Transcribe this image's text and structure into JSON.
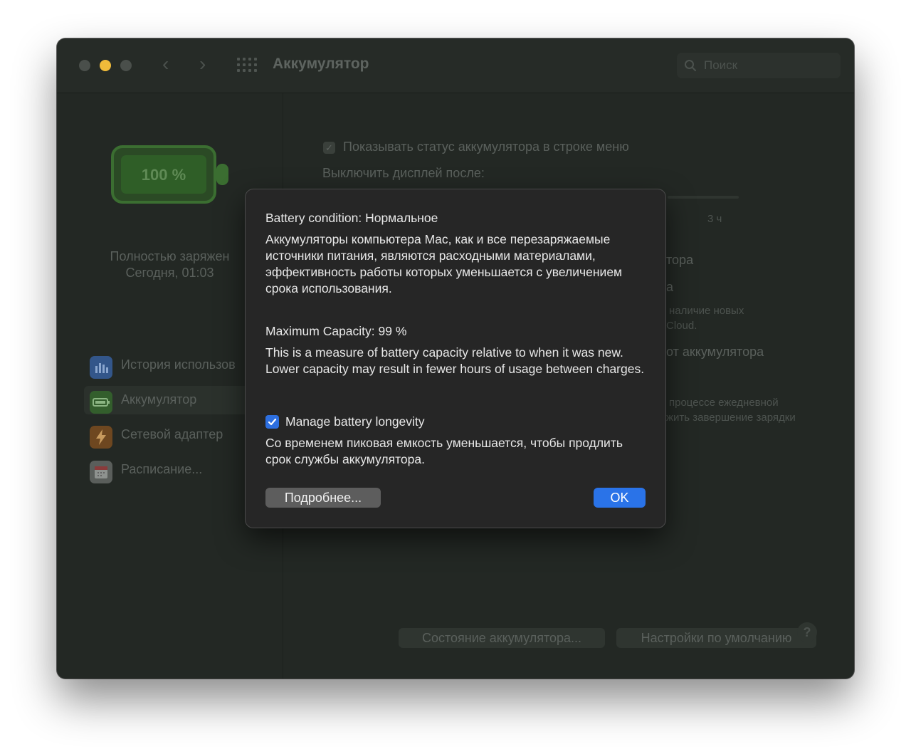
{
  "window": {
    "title": "Аккумулятор",
    "search_placeholder": "Поиск"
  },
  "sidebar": {
    "battery_percent": "100 %",
    "status_line1": "Полностью заряжен",
    "status_line2": "Сегодня, 01:03",
    "items": [
      {
        "label": "История использов",
        "icon": "usage-history-icon",
        "color": "#3a6fb5"
      },
      {
        "label": "Аккумулятор",
        "icon": "battery-icon",
        "color": "#3e7a34"
      },
      {
        "label": "Сетевой адаптер",
        "icon": "power-adapter-icon",
        "color": "#b56b1f"
      },
      {
        "label": "Расписание...",
        "icon": "calendar-icon",
        "color": "#8a8a8a"
      }
    ]
  },
  "main": {
    "show_status_label": "Показывать статус аккумулятора в строке меню",
    "turn_off_display_label": "Выключить дисплей после:",
    "slider_max_label": "3 ч",
    "partial_1": "тора",
    "partial_2": "а",
    "partial_3a": "наличие новых",
    "partial_3b": "Cloud.",
    "partial_4": "от аккумулятора",
    "partial_5a": "процессе ежедневной",
    "partial_5b": "жить завершение зарядки",
    "battery_status_button": "Состояние аккумулятора...",
    "defaults_button": "Настройки по умолчанию",
    "help_label": "?"
  },
  "dialog": {
    "condition": "Battery condition: Нормальное",
    "condition_desc": "Аккумуляторы компьютера Mac, как и все перезаряжаемые источники питания, являются расходными материалами, эффективность работы которых уменьшается с увеличением срока использования.",
    "capacity": "Maximum Capacity: 99 %",
    "capacity_desc": "This is a measure of battery capacity relative to when it was new. Lower capacity may result in fewer hours of usage between charges.",
    "manage_label": "Manage battery longevity",
    "manage_checked": true,
    "manage_desc": "Со временем пиковая емкость уменьшается, чтобы продлить срок службы аккумулятора.",
    "more_button": "Подробнее...",
    "ok_button": "OK"
  },
  "colors": {
    "accent": "#2a73e8",
    "battery_green": "#3f8a35"
  }
}
